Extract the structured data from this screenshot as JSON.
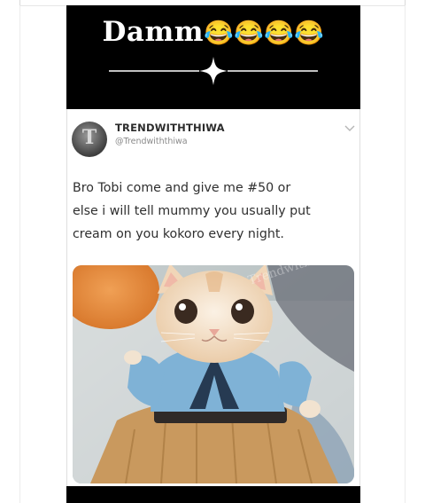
{
  "header": {
    "title": "Damm",
    "emoji": "😂😂😂😂"
  },
  "tweet": {
    "display_name": "TRENDWITHTHIWA",
    "handle": "@Trendwiththiwa",
    "avatar_letter": "T",
    "text_lines": [
      "Bro Tobi come and give me #50 or",
      "else i will tell mummy you usually put",
      "cream on you kokoro every night."
    ],
    "photo": {
      "subject": "cat-in-costume",
      "watermark": "Trendwiththiwa"
    }
  },
  "colors": {
    "background": "#000000",
    "card": "#ffffff",
    "text": "#2f2f2f",
    "handle": "#8a8a8a",
    "costume_blue": "#7fb2d6",
    "skirt": "#c9995e"
  }
}
